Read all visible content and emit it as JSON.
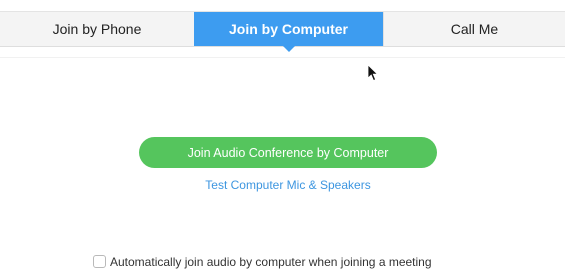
{
  "tabs": [
    {
      "label": "Join by Phone",
      "selected": false
    },
    {
      "label": "Join by Computer",
      "selected": true
    },
    {
      "label": "Call Me",
      "selected": false
    }
  ],
  "main": {
    "join_button_label": "Join Audio Conference by Computer",
    "test_link_label": "Test Computer Mic & Speakers",
    "auto_join_label": "Automatically join audio by computer when joining a meeting",
    "auto_join_checked": false
  },
  "colors": {
    "accent": "#3d9cf0",
    "join_button": "#55c55d",
    "link": "#3d96e0"
  },
  "icons": [
    "mouse-pointer-icon",
    "caret-down-icon"
  ]
}
